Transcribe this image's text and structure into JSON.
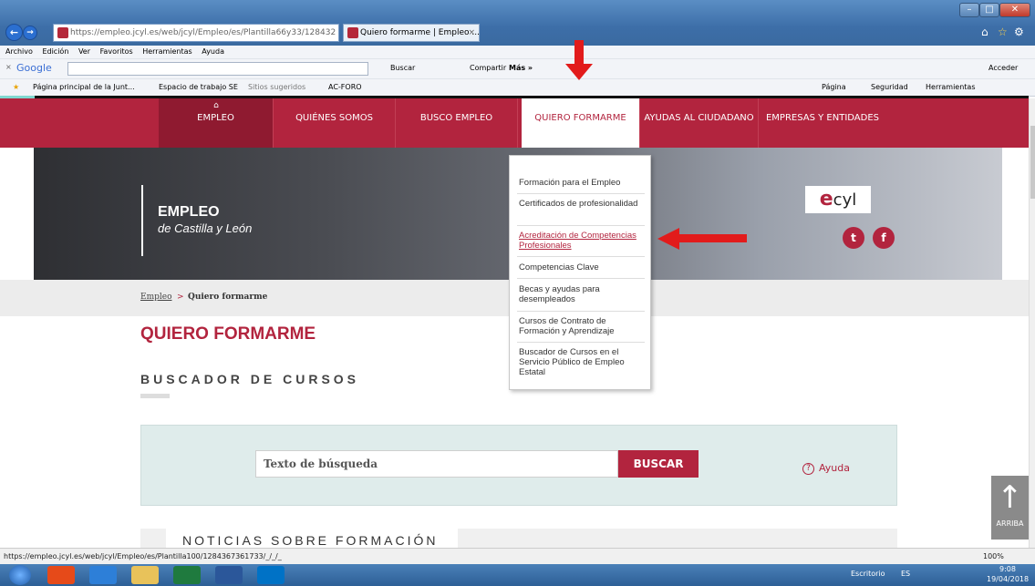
{
  "browser": {
    "address": "https://empleo.jcyl.es/web/jcyl/Empleo/es/Plantilla66y33/128432",
    "address_domain": "empleo.jcyl.es",
    "tab_title": "Quiero formarme | Empleo ...",
    "menu": [
      "Archivo",
      "Edición",
      "Ver",
      "Favoritos",
      "Herramientas",
      "Ayuda"
    ],
    "google_label": "Google",
    "google_tools": {
      "search": "Buscar",
      "share": "Compartir",
      "more": "Más »",
      "sign_in": "Acceder"
    },
    "favorites": [
      "Página principal de la Junt...",
      "Espacio de trabajo SE",
      "Sitios sugeridos",
      "AC-FORO"
    ],
    "command_bar": [
      "Página",
      "Seguridad",
      "Herramientas"
    ],
    "status_url": "https://empleo.jcyl.es/web/jcyl/Empleo/es/Plantilla100/1284367361733/_/_/_",
    "zoom": "100%"
  },
  "site_nav": {
    "items": [
      {
        "label": "EMPLEO"
      },
      {
        "label": "QUIÉNES SOMOS"
      },
      {
        "label": "BUSCO EMPLEO"
      },
      {
        "label": "QUIERO FORMARME"
      },
      {
        "label": "AYUDAS AL CIUDADANO"
      },
      {
        "label": "EMPRESAS Y ENTIDADES"
      }
    ]
  },
  "hero": {
    "title": "EMPLEO",
    "subtitle": "de Castilla y León",
    "logo_e": "e",
    "logo_text": "cyl",
    "twitter": "t",
    "facebook": "f"
  },
  "dropdown": [
    "Formación para el Empleo",
    "Certificados de profesionalidad",
    "Acreditación de Competencias Profesionales",
    "Competencias Clave",
    "Becas y ayudas para desempleados",
    "Cursos de Contrato de Formación y Aprendizaje",
    "Buscador de Cursos en el Servicio Público de Empleo Estatal"
  ],
  "breadcrumb": {
    "home": "Empleo",
    "sep": ">",
    "current": "Quiero formarme"
  },
  "main": {
    "title": "QUIERO FORMARME",
    "subtitle": "BUSCADOR DE CURSOS",
    "search_placeholder": "Texto de búsqueda",
    "search_button": "BUSCAR",
    "help": "Ayuda",
    "news_title": "NOTICIAS SOBRE FORMACIÓN"
  },
  "scroll_top": "ARRIBA",
  "taskbar": {
    "desktop": "Escritorio",
    "lang": "ES",
    "time": "9:08",
    "date": "19/04/2018"
  },
  "colors": {
    "brand": "#b2243e",
    "arrow": "#e21b1b"
  }
}
